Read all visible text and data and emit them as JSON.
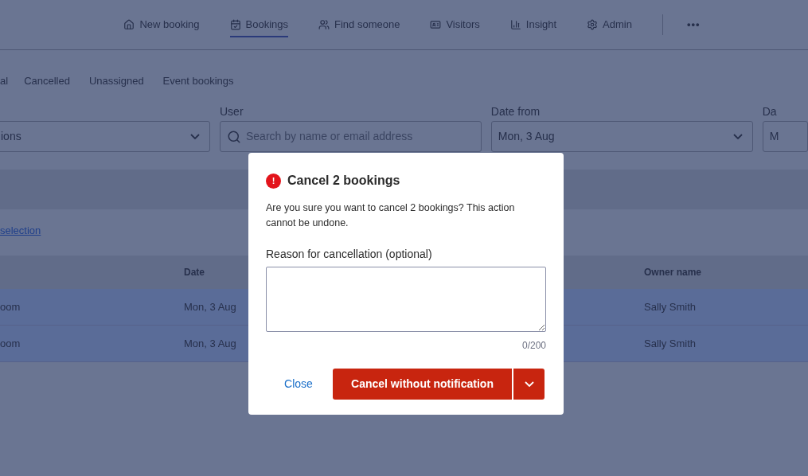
{
  "nav": [
    {
      "label": "New booking",
      "selected": false
    },
    {
      "label": "Bookings",
      "selected": true
    },
    {
      "label": "Find someone",
      "selected": false
    },
    {
      "label": "Visitors",
      "selected": false
    },
    {
      "label": "Insight",
      "selected": false
    },
    {
      "label": "Admin",
      "selected": false
    }
  ],
  "more": "•••",
  "tabs": [
    {
      "label": "al"
    },
    {
      "label": "Cancelled"
    },
    {
      "label": "Unassigned"
    },
    {
      "label": "Event bookings"
    }
  ],
  "filters": [
    {
      "value": "ions",
      "kind": "select"
    },
    {
      "label": "User",
      "placeholder": "Search by name or email address",
      "kind": "search"
    },
    {
      "label": "Date from",
      "value": "Mon, 3 Aug",
      "kind": "select"
    },
    {
      "label": "Da",
      "value": "M",
      "kind": "cut"
    }
  ],
  "clear_link": "selection",
  "table": {
    "columns": [
      "",
      "Date",
      "Owner name"
    ],
    "rows": [
      {
        "cells": [
          "oom",
          "Mon, 3 Aug",
          "Sally Smith"
        ],
        "selected": true
      },
      {
        "cells": [
          "oom",
          "Mon, 3 Aug",
          "Sally Smith"
        ],
        "selected": true
      }
    ]
  },
  "dialog": {
    "title": "Cancel 2 bookings",
    "alert_icon": "!",
    "message": "Are you sure you want to cancel 2 bookings? This action cannot be undone.",
    "field_label": "Reason for cancellation (optional)",
    "counter": "0/200",
    "close": "Close",
    "confirm": "Cancel without notification"
  }
}
